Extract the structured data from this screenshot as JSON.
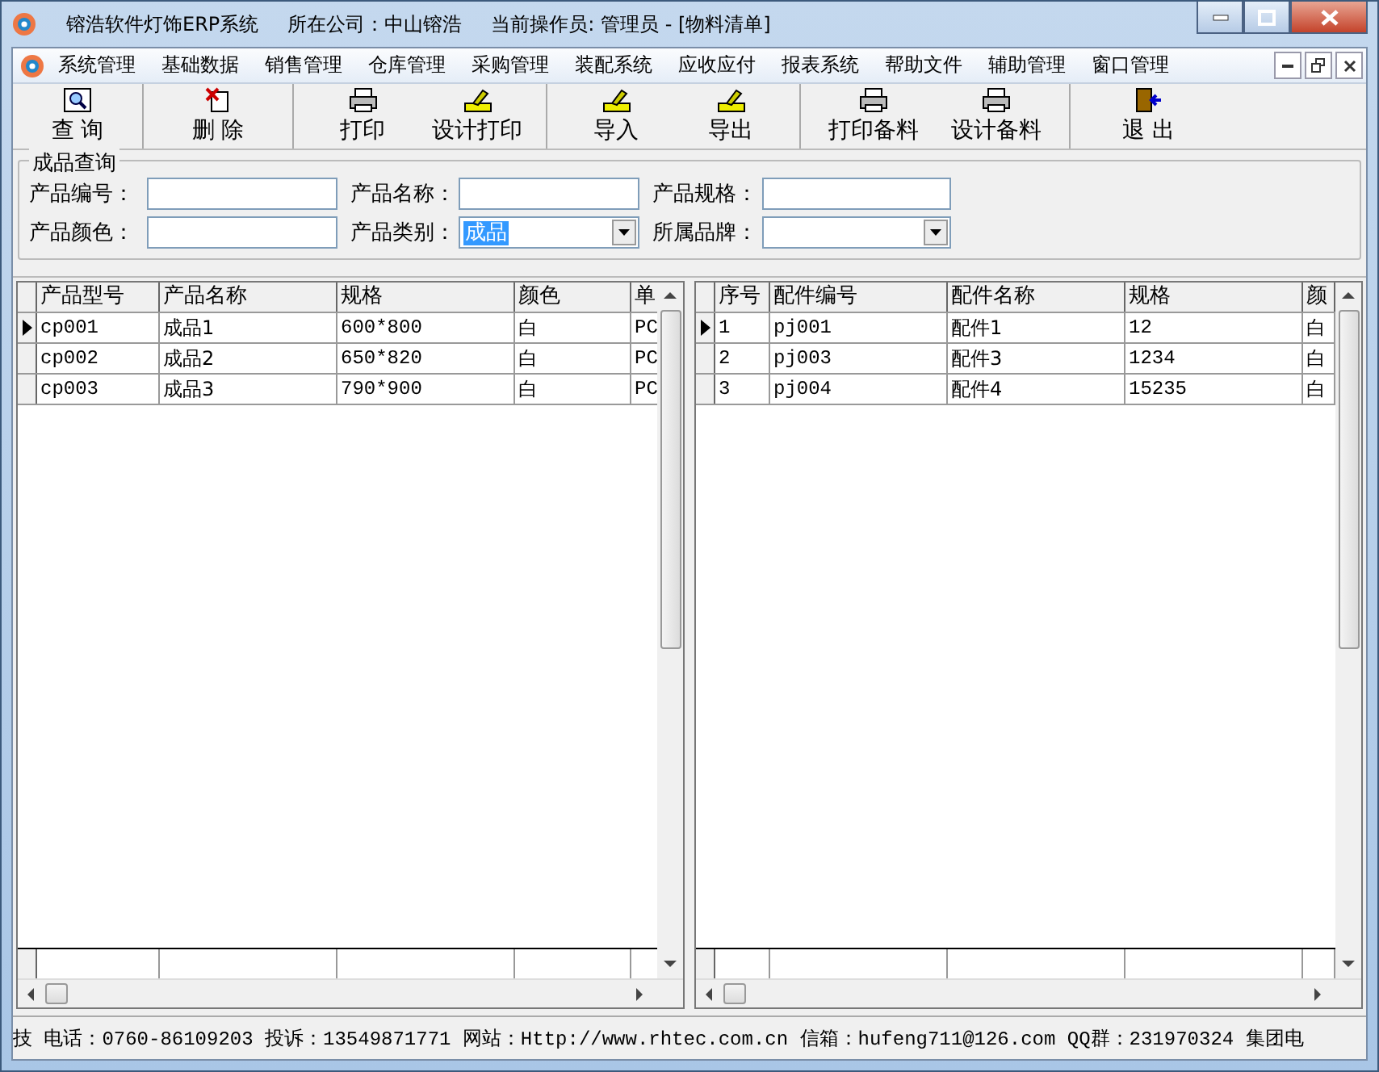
{
  "window": {
    "title": "镕浩软件灯饰ERP系统",
    "company": "所在公司：中山镕浩",
    "operator": "当前操作员: 管理员 - [物料清单]"
  },
  "menu": [
    "系统管理",
    "基础数据",
    "销售管理",
    "仓库管理",
    "采购管理",
    "装配系统",
    "应收应付",
    "报表系统",
    "帮助文件",
    "辅助管理",
    "窗口管理"
  ],
  "toolbar": [
    [
      {
        "label": "查 询",
        "kind": "search"
      }
    ],
    [
      {
        "label": "删 除",
        "kind": "delete"
      }
    ],
    [
      {
        "label": "打印",
        "kind": "print"
      },
      {
        "label": "设计打印",
        "kind": "design"
      }
    ],
    [
      {
        "label": "导入",
        "kind": "design"
      },
      {
        "label": "导出",
        "kind": "design"
      }
    ],
    [
      {
        "label": "打印备料",
        "kind": "print"
      },
      {
        "label": "设计备料",
        "kind": "print"
      }
    ],
    [
      {
        "label": "退 出",
        "kind": "exit"
      }
    ]
  ],
  "query": {
    "title": "成品查询",
    "fields": [
      {
        "label": "产品编号：",
        "kind": "text"
      },
      {
        "label": "产品名称：",
        "kind": "text"
      },
      {
        "label": "产品规格：",
        "kind": "text"
      },
      {
        "label": "产品颜色：",
        "kind": "text"
      },
      {
        "label": "产品类别：",
        "kind": "combo",
        "value": "成品",
        "highlighted": true
      },
      {
        "label": "所属品牌：",
        "kind": "combo"
      }
    ]
  },
  "products": {
    "columns": [
      "产品型号",
      "产品名称",
      "规格",
      "颜色",
      "单"
    ],
    "rows": [
      {
        "cells": [
          "cp001",
          "成品1",
          "600*800",
          "白",
          "PC"
        ],
        "selected": true
      },
      {
        "cells": [
          "cp002",
          "成品2",
          "650*820",
          "白",
          "PC"
        ],
        "selected": false
      },
      {
        "cells": [
          "cp003",
          "成品3",
          "790*900",
          "白",
          "PC"
        ],
        "selected": false
      }
    ]
  },
  "parts": {
    "columns": [
      "序号",
      "配件编号",
      "配件名称",
      "规格",
      "颜"
    ],
    "rows": [
      {
        "cells": [
          "1",
          "pj001",
          "配件1",
          "12",
          "白"
        ],
        "selected": true
      },
      {
        "cells": [
          "2",
          "pj003",
          "配件3",
          "1234",
          "白"
        ],
        "selected": false
      },
      {
        "cells": [
          "3",
          "pj004",
          "配件4",
          "15235",
          "白"
        ],
        "selected": false
      }
    ]
  },
  "status_bar": "技 电话：0760-86109203 投诉：13549871771 网站：Http://www.rhtec.com.cn 信箱：hufeng711@126.com QQ群：231970324 集团电"
}
